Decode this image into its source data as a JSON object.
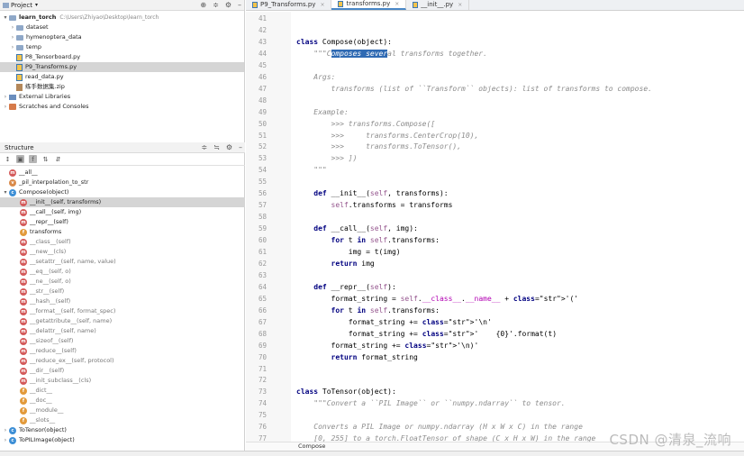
{
  "project": {
    "header_title": "Project",
    "root_name": "learn_torch",
    "root_path": "C:\\Users\\Zhiyao\\Desktop\\learn_torch",
    "items": [
      {
        "label": "dataset",
        "kind": "folder"
      },
      {
        "label": "hymenoptera_data",
        "kind": "folder"
      },
      {
        "label": "temp",
        "kind": "folder"
      },
      {
        "label": "P8_Tensorboard.py",
        "kind": "py"
      },
      {
        "label": "P9_Transforms.py",
        "kind": "py"
      },
      {
        "label": "read_data.py",
        "kind": "py"
      },
      {
        "label": "练手数据集.zip",
        "kind": "zip"
      }
    ],
    "external_libraries": "External Libraries",
    "scratches": "Scratches and Consoles"
  },
  "structure": {
    "header_title": "Structure",
    "items": [
      {
        "label": "__all__",
        "marker": "red"
      },
      {
        "label": "_pil_interpolation_to_str",
        "marker": "o"
      },
      {
        "label": "Compose(object)",
        "marker": "c"
      },
      {
        "label": "__init__(self, transforms)",
        "marker": "red"
      },
      {
        "label": "__call__(self, img)",
        "marker": "red"
      },
      {
        "label": "__repr__(self)",
        "marker": "red"
      },
      {
        "label": "transforms",
        "marker": "f"
      },
      {
        "label": "__class__(self)",
        "marker": "red"
      },
      {
        "label": "__new__(cls)",
        "marker": "red"
      },
      {
        "label": "__setattr__(self, name, value)",
        "marker": "red"
      },
      {
        "label": "__eq__(self, o)",
        "marker": "red"
      },
      {
        "label": "__ne__(self, o)",
        "marker": "red"
      },
      {
        "label": "__str__(self)",
        "marker": "red"
      },
      {
        "label": "__hash__(self)",
        "marker": "red"
      },
      {
        "label": "__format__(self, format_spec)",
        "marker": "red"
      },
      {
        "label": "__getattribute__(self, name)",
        "marker": "red"
      },
      {
        "label": "__delattr__(self, name)",
        "marker": "red"
      },
      {
        "label": "__sizeof__(self)",
        "marker": "red"
      },
      {
        "label": "__reduce__(self)",
        "marker": "red"
      },
      {
        "label": "__reduce_ex__(self, protocol)",
        "marker": "red"
      },
      {
        "label": "__dir__(self)",
        "marker": "red"
      },
      {
        "label": "__init_subclass__(cls)",
        "marker": "red"
      },
      {
        "label": "__dict__",
        "marker": "f"
      },
      {
        "label": "__doc__",
        "marker": "f"
      },
      {
        "label": "__module__",
        "marker": "f"
      },
      {
        "label": "__slots__",
        "marker": "f"
      },
      {
        "label": "ToTensor(object)",
        "marker": "c"
      },
      {
        "label": "ToPILImage(object)",
        "marker": "c"
      }
    ]
  },
  "tabs": [
    {
      "label": "P9_Transforms.py"
    },
    {
      "label": "transforms.py"
    },
    {
      "label": "__init__.py"
    }
  ],
  "editor": {
    "line_numbers": [
      "41",
      "42",
      "43",
      "44",
      "45",
      "46",
      "47",
      "48",
      "49",
      "50",
      "51",
      "52",
      "53",
      "54",
      "55",
      "56",
      "57",
      "58",
      "59",
      "60",
      "61",
      "62",
      "63",
      "64",
      "65",
      "66",
      "67",
      "68",
      "69",
      "70",
      "71",
      "72",
      "73",
      "74",
      "75",
      "76",
      "77"
    ],
    "code_lines": [
      "",
      "",
      "class Compose(object):",
      "    \"\"\"Composes several transforms together.",
      "",
      "    Args:",
      "        transforms (list of ``Transform`` objects): list of transforms to compose.",
      "",
      "    Example:",
      "        >>> transforms.Compose([",
      "        >>>     transforms.CenterCrop(10),",
      "        >>>     transforms.ToTensor(),",
      "        >>> ])",
      "    \"\"\"",
      "",
      "    def __init__(self, transforms):",
      "        self.transforms = transforms",
      "",
      "    def __call__(self, img):",
      "        for t in self.transforms:",
      "            img = t(img)",
      "        return img",
      "",
      "    def __repr__(self):",
      "        format_string = self.__class__.__name__ + '('",
      "        for t in self.transforms:",
      "            format_string += '\\n'",
      "            format_string += '    {0}'.format(t)",
      "        format_string += '\\n)'",
      "        return format_string",
      "",
      "",
      "class ToTensor(object):",
      "    \"\"\"Convert a ``PIL Image`` or ``numpy.ndarray`` to tensor.",
      "",
      "    Converts a PIL Image or numpy.ndarray (H x W x C) in the range",
      "    [0, 255] to a torch.FloatTensor of shape (C x H x W) in the range"
    ],
    "selection": "omposes sever",
    "breadcrumb": "Compose"
  },
  "watermark": "CSDN @清泉_流响"
}
